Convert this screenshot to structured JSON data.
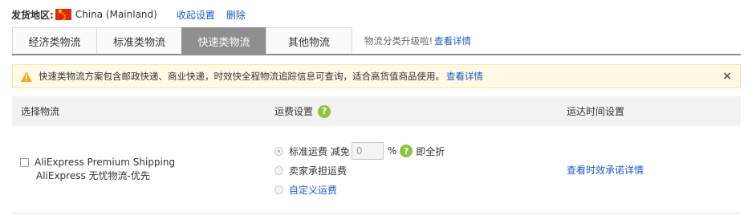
{
  "origin": {
    "label": "发货地区:",
    "country": "China (Mainland)",
    "collapse_link": "收起设置",
    "delete_link": "删除",
    "flag_color": "#de2910"
  },
  "tabs": {
    "items": [
      {
        "label": "经济类物流",
        "active": false
      },
      {
        "label": "标准类物流",
        "active": false
      },
      {
        "label": "快速类物流",
        "active": true
      },
      {
        "label": "其他物流",
        "active": false
      }
    ],
    "note": "物流分类升级啦!",
    "note_link": "查看详情",
    "active_color": "#8e8e8e"
  },
  "alert": {
    "icon": "warning-icon",
    "text": "快速类物流方案包含邮政快递、商业快递，时效快全程物流追踪信息可查询，适合高货值商品使用。",
    "link": "查看详情",
    "close": "×",
    "background": "#fff9e6"
  },
  "table": {
    "headers": {
      "method": "选择物流",
      "shipping_fee": "运费设置",
      "delivery_time": "运达时间设置"
    },
    "help_icon": "?",
    "rows": [
      {
        "method_en": "AliExpress Premium Shipping",
        "method_cn": "AliExpress 无忧物流-优先",
        "fee_options": {
          "standard_label": "标准运费 减免",
          "discount_value": "0",
          "percent": "%",
          "full_discount": "即全折",
          "seller_pays": "卖家承担运费",
          "custom": "自定义运费"
        },
        "time_link": "查看时效承诺详情"
      }
    ]
  },
  "colors": {
    "link": "#1a5ec2",
    "help_icon": "#8cc63f",
    "warning": "#f5a623"
  }
}
